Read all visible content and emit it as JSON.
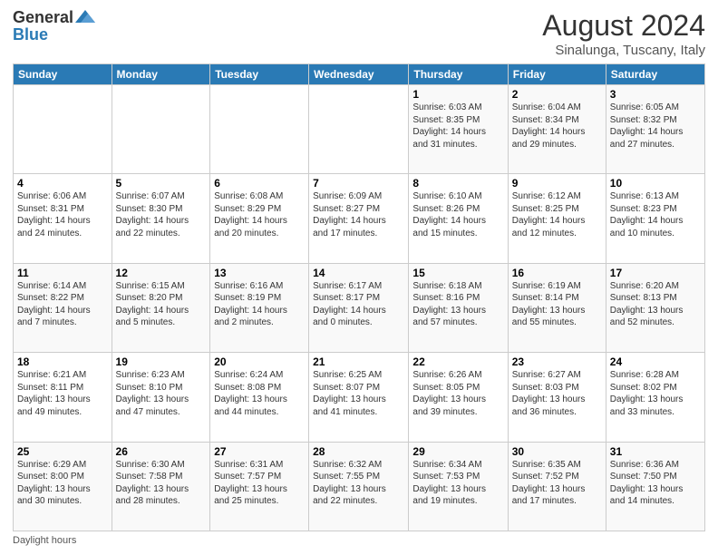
{
  "header": {
    "logo_general": "General",
    "logo_blue": "Blue",
    "month_year": "August 2024",
    "location": "Sinalunga, Tuscany, Italy"
  },
  "weekdays": [
    "Sunday",
    "Monday",
    "Tuesday",
    "Wednesday",
    "Thursday",
    "Friday",
    "Saturday"
  ],
  "weeks": [
    [
      {
        "day": "",
        "info": ""
      },
      {
        "day": "",
        "info": ""
      },
      {
        "day": "",
        "info": ""
      },
      {
        "day": "",
        "info": ""
      },
      {
        "day": "1",
        "info": "Sunrise: 6:03 AM\nSunset: 8:35 PM\nDaylight: 14 hours\nand 31 minutes."
      },
      {
        "day": "2",
        "info": "Sunrise: 6:04 AM\nSunset: 8:34 PM\nDaylight: 14 hours\nand 29 minutes."
      },
      {
        "day": "3",
        "info": "Sunrise: 6:05 AM\nSunset: 8:32 PM\nDaylight: 14 hours\nand 27 minutes."
      }
    ],
    [
      {
        "day": "4",
        "info": "Sunrise: 6:06 AM\nSunset: 8:31 PM\nDaylight: 14 hours\nand 24 minutes."
      },
      {
        "day": "5",
        "info": "Sunrise: 6:07 AM\nSunset: 8:30 PM\nDaylight: 14 hours\nand 22 minutes."
      },
      {
        "day": "6",
        "info": "Sunrise: 6:08 AM\nSunset: 8:29 PM\nDaylight: 14 hours\nand 20 minutes."
      },
      {
        "day": "7",
        "info": "Sunrise: 6:09 AM\nSunset: 8:27 PM\nDaylight: 14 hours\nand 17 minutes."
      },
      {
        "day": "8",
        "info": "Sunrise: 6:10 AM\nSunset: 8:26 PM\nDaylight: 14 hours\nand 15 minutes."
      },
      {
        "day": "9",
        "info": "Sunrise: 6:12 AM\nSunset: 8:25 PM\nDaylight: 14 hours\nand 12 minutes."
      },
      {
        "day": "10",
        "info": "Sunrise: 6:13 AM\nSunset: 8:23 PM\nDaylight: 14 hours\nand 10 minutes."
      }
    ],
    [
      {
        "day": "11",
        "info": "Sunrise: 6:14 AM\nSunset: 8:22 PM\nDaylight: 14 hours\nand 7 minutes."
      },
      {
        "day": "12",
        "info": "Sunrise: 6:15 AM\nSunset: 8:20 PM\nDaylight: 14 hours\nand 5 minutes."
      },
      {
        "day": "13",
        "info": "Sunrise: 6:16 AM\nSunset: 8:19 PM\nDaylight: 14 hours\nand 2 minutes."
      },
      {
        "day": "14",
        "info": "Sunrise: 6:17 AM\nSunset: 8:17 PM\nDaylight: 14 hours\nand 0 minutes."
      },
      {
        "day": "15",
        "info": "Sunrise: 6:18 AM\nSunset: 8:16 PM\nDaylight: 13 hours\nand 57 minutes."
      },
      {
        "day": "16",
        "info": "Sunrise: 6:19 AM\nSunset: 8:14 PM\nDaylight: 13 hours\nand 55 minutes."
      },
      {
        "day": "17",
        "info": "Sunrise: 6:20 AM\nSunset: 8:13 PM\nDaylight: 13 hours\nand 52 minutes."
      }
    ],
    [
      {
        "day": "18",
        "info": "Sunrise: 6:21 AM\nSunset: 8:11 PM\nDaylight: 13 hours\nand 49 minutes."
      },
      {
        "day": "19",
        "info": "Sunrise: 6:23 AM\nSunset: 8:10 PM\nDaylight: 13 hours\nand 47 minutes."
      },
      {
        "day": "20",
        "info": "Sunrise: 6:24 AM\nSunset: 8:08 PM\nDaylight: 13 hours\nand 44 minutes."
      },
      {
        "day": "21",
        "info": "Sunrise: 6:25 AM\nSunset: 8:07 PM\nDaylight: 13 hours\nand 41 minutes."
      },
      {
        "day": "22",
        "info": "Sunrise: 6:26 AM\nSunset: 8:05 PM\nDaylight: 13 hours\nand 39 minutes."
      },
      {
        "day": "23",
        "info": "Sunrise: 6:27 AM\nSunset: 8:03 PM\nDaylight: 13 hours\nand 36 minutes."
      },
      {
        "day": "24",
        "info": "Sunrise: 6:28 AM\nSunset: 8:02 PM\nDaylight: 13 hours\nand 33 minutes."
      }
    ],
    [
      {
        "day": "25",
        "info": "Sunrise: 6:29 AM\nSunset: 8:00 PM\nDaylight: 13 hours\nand 30 minutes."
      },
      {
        "day": "26",
        "info": "Sunrise: 6:30 AM\nSunset: 7:58 PM\nDaylight: 13 hours\nand 28 minutes."
      },
      {
        "day": "27",
        "info": "Sunrise: 6:31 AM\nSunset: 7:57 PM\nDaylight: 13 hours\nand 25 minutes."
      },
      {
        "day": "28",
        "info": "Sunrise: 6:32 AM\nSunset: 7:55 PM\nDaylight: 13 hours\nand 22 minutes."
      },
      {
        "day": "29",
        "info": "Sunrise: 6:34 AM\nSunset: 7:53 PM\nDaylight: 13 hours\nand 19 minutes."
      },
      {
        "day": "30",
        "info": "Sunrise: 6:35 AM\nSunset: 7:52 PM\nDaylight: 13 hours\nand 17 minutes."
      },
      {
        "day": "31",
        "info": "Sunrise: 6:36 AM\nSunset: 7:50 PM\nDaylight: 13 hours\nand 14 minutes."
      }
    ]
  ],
  "footer": {
    "daylight_label": "Daylight hours"
  }
}
